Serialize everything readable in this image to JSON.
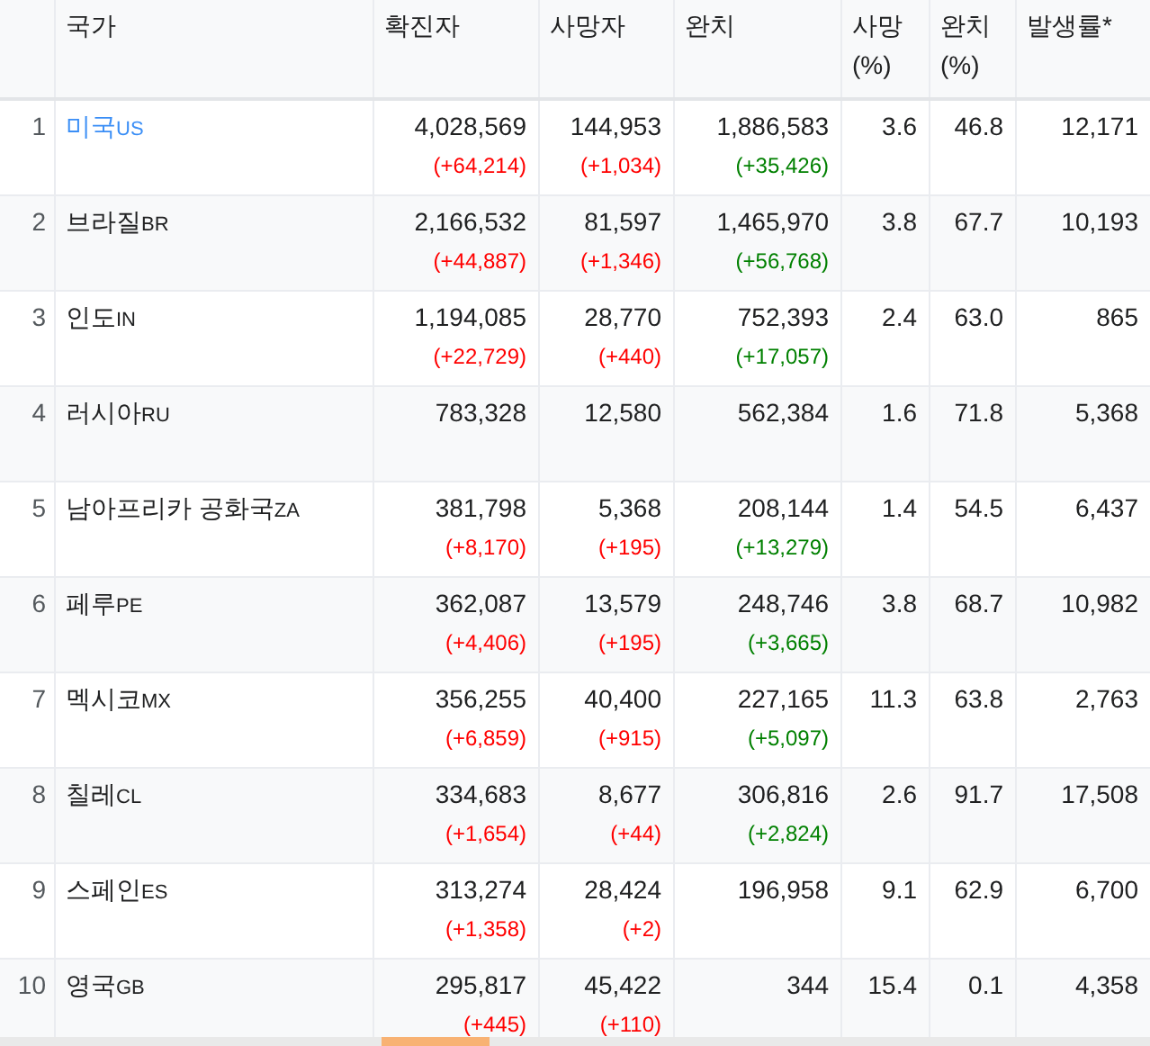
{
  "table": {
    "columns": [
      {
        "kind": "rank"
      },
      {
        "label": "국가",
        "kind": "country"
      },
      {
        "label": "확진자",
        "kind": "count_bad"
      },
      {
        "label": "사망자",
        "kind": "count_bad"
      },
      {
        "label": "완치",
        "kind": "count_good"
      },
      {
        "label": "사망 (%)",
        "kind": "number"
      },
      {
        "label": "완치 (%)",
        "kind": "number"
      },
      {
        "label": "발생률*",
        "kind": "number"
      }
    ],
    "rows": [
      {
        "cells": [
          {
            "value": "1"
          },
          {
            "value": "미국",
            "code": "US",
            "link": true
          },
          {
            "value": "4,028,569",
            "delta": "(+64,214)"
          },
          {
            "value": "144,953",
            "delta": "(+1,034)"
          },
          {
            "value": "1,886,583",
            "delta": "(+35,426)"
          },
          {
            "value": "3.6"
          },
          {
            "value": "46.8"
          },
          {
            "value": "12,171"
          }
        ]
      },
      {
        "cells": [
          {
            "value": "2"
          },
          {
            "value": "브라질",
            "code": "BR",
            "link": false
          },
          {
            "value": "2,166,532",
            "delta": "(+44,887)"
          },
          {
            "value": "81,597",
            "delta": "(+1,346)"
          },
          {
            "value": "1,465,970",
            "delta": "(+56,768)"
          },
          {
            "value": "3.8"
          },
          {
            "value": "67.7"
          },
          {
            "value": "10,193"
          }
        ]
      },
      {
        "cells": [
          {
            "value": "3"
          },
          {
            "value": "인도",
            "code": "IN",
            "link": false
          },
          {
            "value": "1,194,085",
            "delta": "(+22,729)"
          },
          {
            "value": "28,770",
            "delta": "(+440)"
          },
          {
            "value": "752,393",
            "delta": "(+17,057)"
          },
          {
            "value": "2.4"
          },
          {
            "value": "63.0"
          },
          {
            "value": "865"
          }
        ]
      },
      {
        "cells": [
          {
            "value": "4"
          },
          {
            "value": "러시아",
            "code": "RU",
            "link": false
          },
          {
            "value": "783,328"
          },
          {
            "value": "12,580"
          },
          {
            "value": "562,384"
          },
          {
            "value": "1.6"
          },
          {
            "value": "71.8"
          },
          {
            "value": "5,368"
          }
        ]
      },
      {
        "cells": [
          {
            "value": "5"
          },
          {
            "value": "남아프리카 공화국",
            "code": "ZA",
            "link": false
          },
          {
            "value": "381,798",
            "delta": "(+8,170)"
          },
          {
            "value": "5,368",
            "delta": "(+195)"
          },
          {
            "value": "208,144",
            "delta": "(+13,279)"
          },
          {
            "value": "1.4"
          },
          {
            "value": "54.5"
          },
          {
            "value": "6,437"
          }
        ]
      },
      {
        "cells": [
          {
            "value": "6"
          },
          {
            "value": "페루",
            "code": "PE",
            "link": false
          },
          {
            "value": "362,087",
            "delta": "(+4,406)"
          },
          {
            "value": "13,579",
            "delta": "(+195)"
          },
          {
            "value": "248,746",
            "delta": "(+3,665)"
          },
          {
            "value": "3.8"
          },
          {
            "value": "68.7"
          },
          {
            "value": "10,982"
          }
        ]
      },
      {
        "cells": [
          {
            "value": "7"
          },
          {
            "value": "멕시코",
            "code": "MX",
            "link": false
          },
          {
            "value": "356,255",
            "delta": "(+6,859)"
          },
          {
            "value": "40,400",
            "delta": "(+915)"
          },
          {
            "value": "227,165",
            "delta": "(+5,097)"
          },
          {
            "value": "11.3"
          },
          {
            "value": "63.8"
          },
          {
            "value": "2,763"
          }
        ]
      },
      {
        "cells": [
          {
            "value": "8"
          },
          {
            "value": "칠레",
            "code": "CL",
            "link": false
          },
          {
            "value": "334,683",
            "delta": "(+1,654)"
          },
          {
            "value": "8,677",
            "delta": "(+44)"
          },
          {
            "value": "306,816",
            "delta": "(+2,824)"
          },
          {
            "value": "2.6"
          },
          {
            "value": "91.7"
          },
          {
            "value": "17,508"
          }
        ]
      },
      {
        "cells": [
          {
            "value": "9"
          },
          {
            "value": "스페인",
            "code": "ES",
            "link": false
          },
          {
            "value": "313,274",
            "delta": "(+1,358)"
          },
          {
            "value": "28,424",
            "delta": "(+2)"
          },
          {
            "value": "196,958"
          },
          {
            "value": "9.1"
          },
          {
            "value": "62.9"
          },
          {
            "value": "6,700"
          }
        ]
      },
      {
        "cells": [
          {
            "value": "10"
          },
          {
            "value": "영국",
            "code": "GB",
            "link": false
          },
          {
            "value": "295,817",
            "delta": "(+445)"
          },
          {
            "value": "45,422",
            "delta": "(+110)"
          },
          {
            "value": "344"
          },
          {
            "value": "15.4"
          },
          {
            "value": "0.1"
          },
          {
            "value": "4,358"
          }
        ]
      }
    ]
  }
}
